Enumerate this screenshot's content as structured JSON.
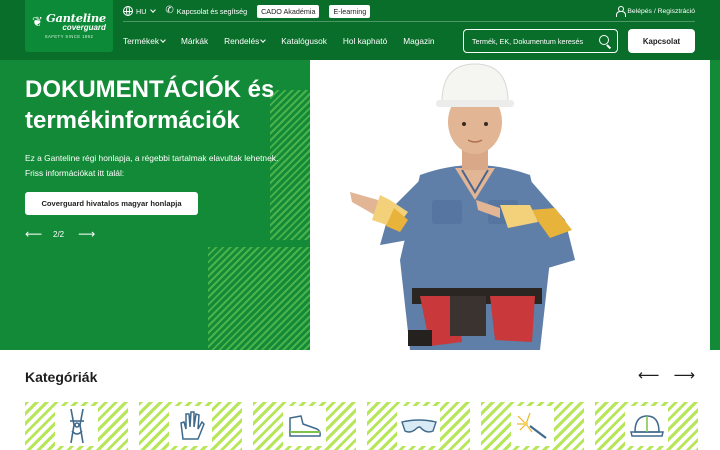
{
  "header": {
    "logo": {
      "name": "Ganteline",
      "sub": "coverguard",
      "tagline": "SAFETY SINCE 1892"
    },
    "language": "HU",
    "contact_label": "Kapcsolat és segítség",
    "pills": [
      "CADO Akadémia",
      "E-learning"
    ],
    "login_label": "Belépés / Regisztráció",
    "nav": [
      {
        "label": "Termékek",
        "dropdown": true
      },
      {
        "label": "Márkák",
        "dropdown": false
      },
      {
        "label": "Rendelés",
        "dropdown": true
      },
      {
        "label": "Katalógusok",
        "dropdown": false
      },
      {
        "label": "Hol kapható",
        "dropdown": false
      },
      {
        "label": "Magazin",
        "dropdown": false
      }
    ],
    "search_placeholder": "Termék, EK, Dokumentum keresés",
    "cta_label": "Kapcsolat"
  },
  "hero": {
    "title_line1": "DOKUMENTÁCIÓK és",
    "title_line2": "termékinformációk",
    "text_line1": "Ez a Ganteline régi honlapja, a régebbi tartalmak elavultak lehetnek.",
    "text_line2": "Friss információkat itt talál:",
    "button_label": "Coverguard hivatalos magyar honlapja",
    "pager": "2/2"
  },
  "categories": {
    "title": "Kategóriák",
    "items": [
      {
        "icon": "harness-icon"
      },
      {
        "icon": "glove-icon"
      },
      {
        "icon": "safety-shoe-icon"
      },
      {
        "icon": "safety-glasses-icon"
      },
      {
        "icon": "welding-icon"
      },
      {
        "icon": "hard-hat-icon"
      }
    ]
  },
  "colors": {
    "brand_green": "#0a6e2b",
    "hero_green": "#138a37",
    "accent_lime": "#b7e65a"
  }
}
